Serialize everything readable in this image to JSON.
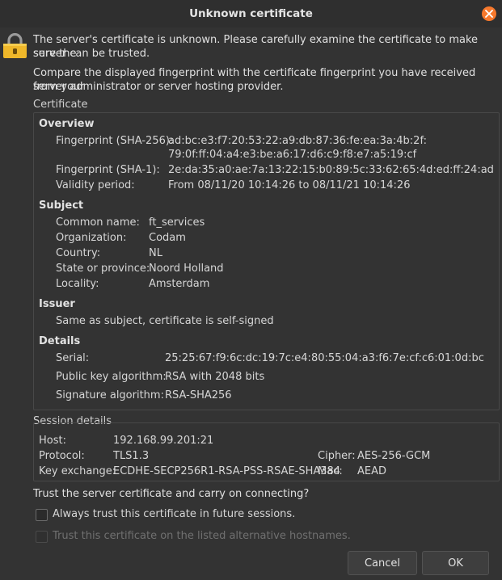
{
  "dialog": {
    "title": "Unknown certificate"
  },
  "message": {
    "line1": "The server's certificate is unknown. Please carefully examine the certificate to make sure the",
    "line2": "server can be trusted.",
    "line3": "Compare the displayed fingerprint with the certificate fingerprint you have received from your",
    "line4": "server administrator or server hosting provider."
  },
  "certificate": {
    "group_label": "Certificate",
    "overview": {
      "heading": "Overview",
      "fp256_label": "Fingerprint (SHA-256):",
      "fp256_line1": "ad:bc:e3:f7:20:53:22:a9:db:87:36:fe:ea:3a:4b:2f:",
      "fp256_line2": "79:0f:ff:04:a4:e3:be:a6:17:d6:c9:f8:e7:a5:19:cf",
      "fp1_label": "Fingerprint (SHA-1):",
      "fp1_value": "2e:da:35:a0:ae:7a:13:22:15:b0:89:5c:33:62:65:4d:ed:ff:24:ad",
      "validity_label": "Validity period:",
      "validity_value": "From 08/11/20 10:14:26 to 08/11/21 10:14:26"
    },
    "subject": {
      "heading": "Subject",
      "cn_label": "Common name:",
      "cn_value": "ft_services",
      "org_label": "Organization:",
      "org_value": "Codam",
      "country_label": "Country:",
      "country_value": "NL",
      "state_label": "State or province:",
      "state_value": "Noord Holland",
      "locality_label": "Locality:",
      "locality_value": "Amsterdam"
    },
    "issuer": {
      "heading": "Issuer",
      "text": "Same as subject, certificate is self-signed"
    },
    "details": {
      "heading": "Details",
      "serial_label": "Serial:",
      "serial_value": "25:25:67:f9:6c:dc:19:7c:e4:80:55:04:a3:f6:7e:cf:c6:01:0d:bc",
      "pubkey_label": "Public key algorithm:",
      "pubkey_value": "RSA with 2048 bits",
      "sig_label": "Signature algorithm:",
      "sig_value": "RSA-SHA256"
    }
  },
  "session": {
    "group_label": "Session details",
    "host_label": "Host:",
    "host_value": "192.168.99.201:21",
    "protocol_label": "Protocol:",
    "protocol_value": "TLS1.3",
    "kex_label": "Key exchange:",
    "kex_value": "ECDHE-SECP256R1-RSA-PSS-RSAE-SHA384",
    "cipher_label": "Cipher:",
    "cipher_value": "AES-256-GCM",
    "mac_label": "Mac:",
    "mac_value": "AEAD"
  },
  "trust": {
    "question": "Trust the server certificate and carry on connecting?",
    "always_label": "Always trust this certificate in future sessions.",
    "alt_label": "Trust this certificate on the listed alternative hostnames."
  },
  "buttons": {
    "cancel": "Cancel",
    "ok": "OK"
  },
  "colors": {
    "accent_close": "#f6782c",
    "lock": "#f0b82a",
    "background": "#333333"
  },
  "icons": {
    "close": "close-icon",
    "lock": "lock-icon"
  }
}
